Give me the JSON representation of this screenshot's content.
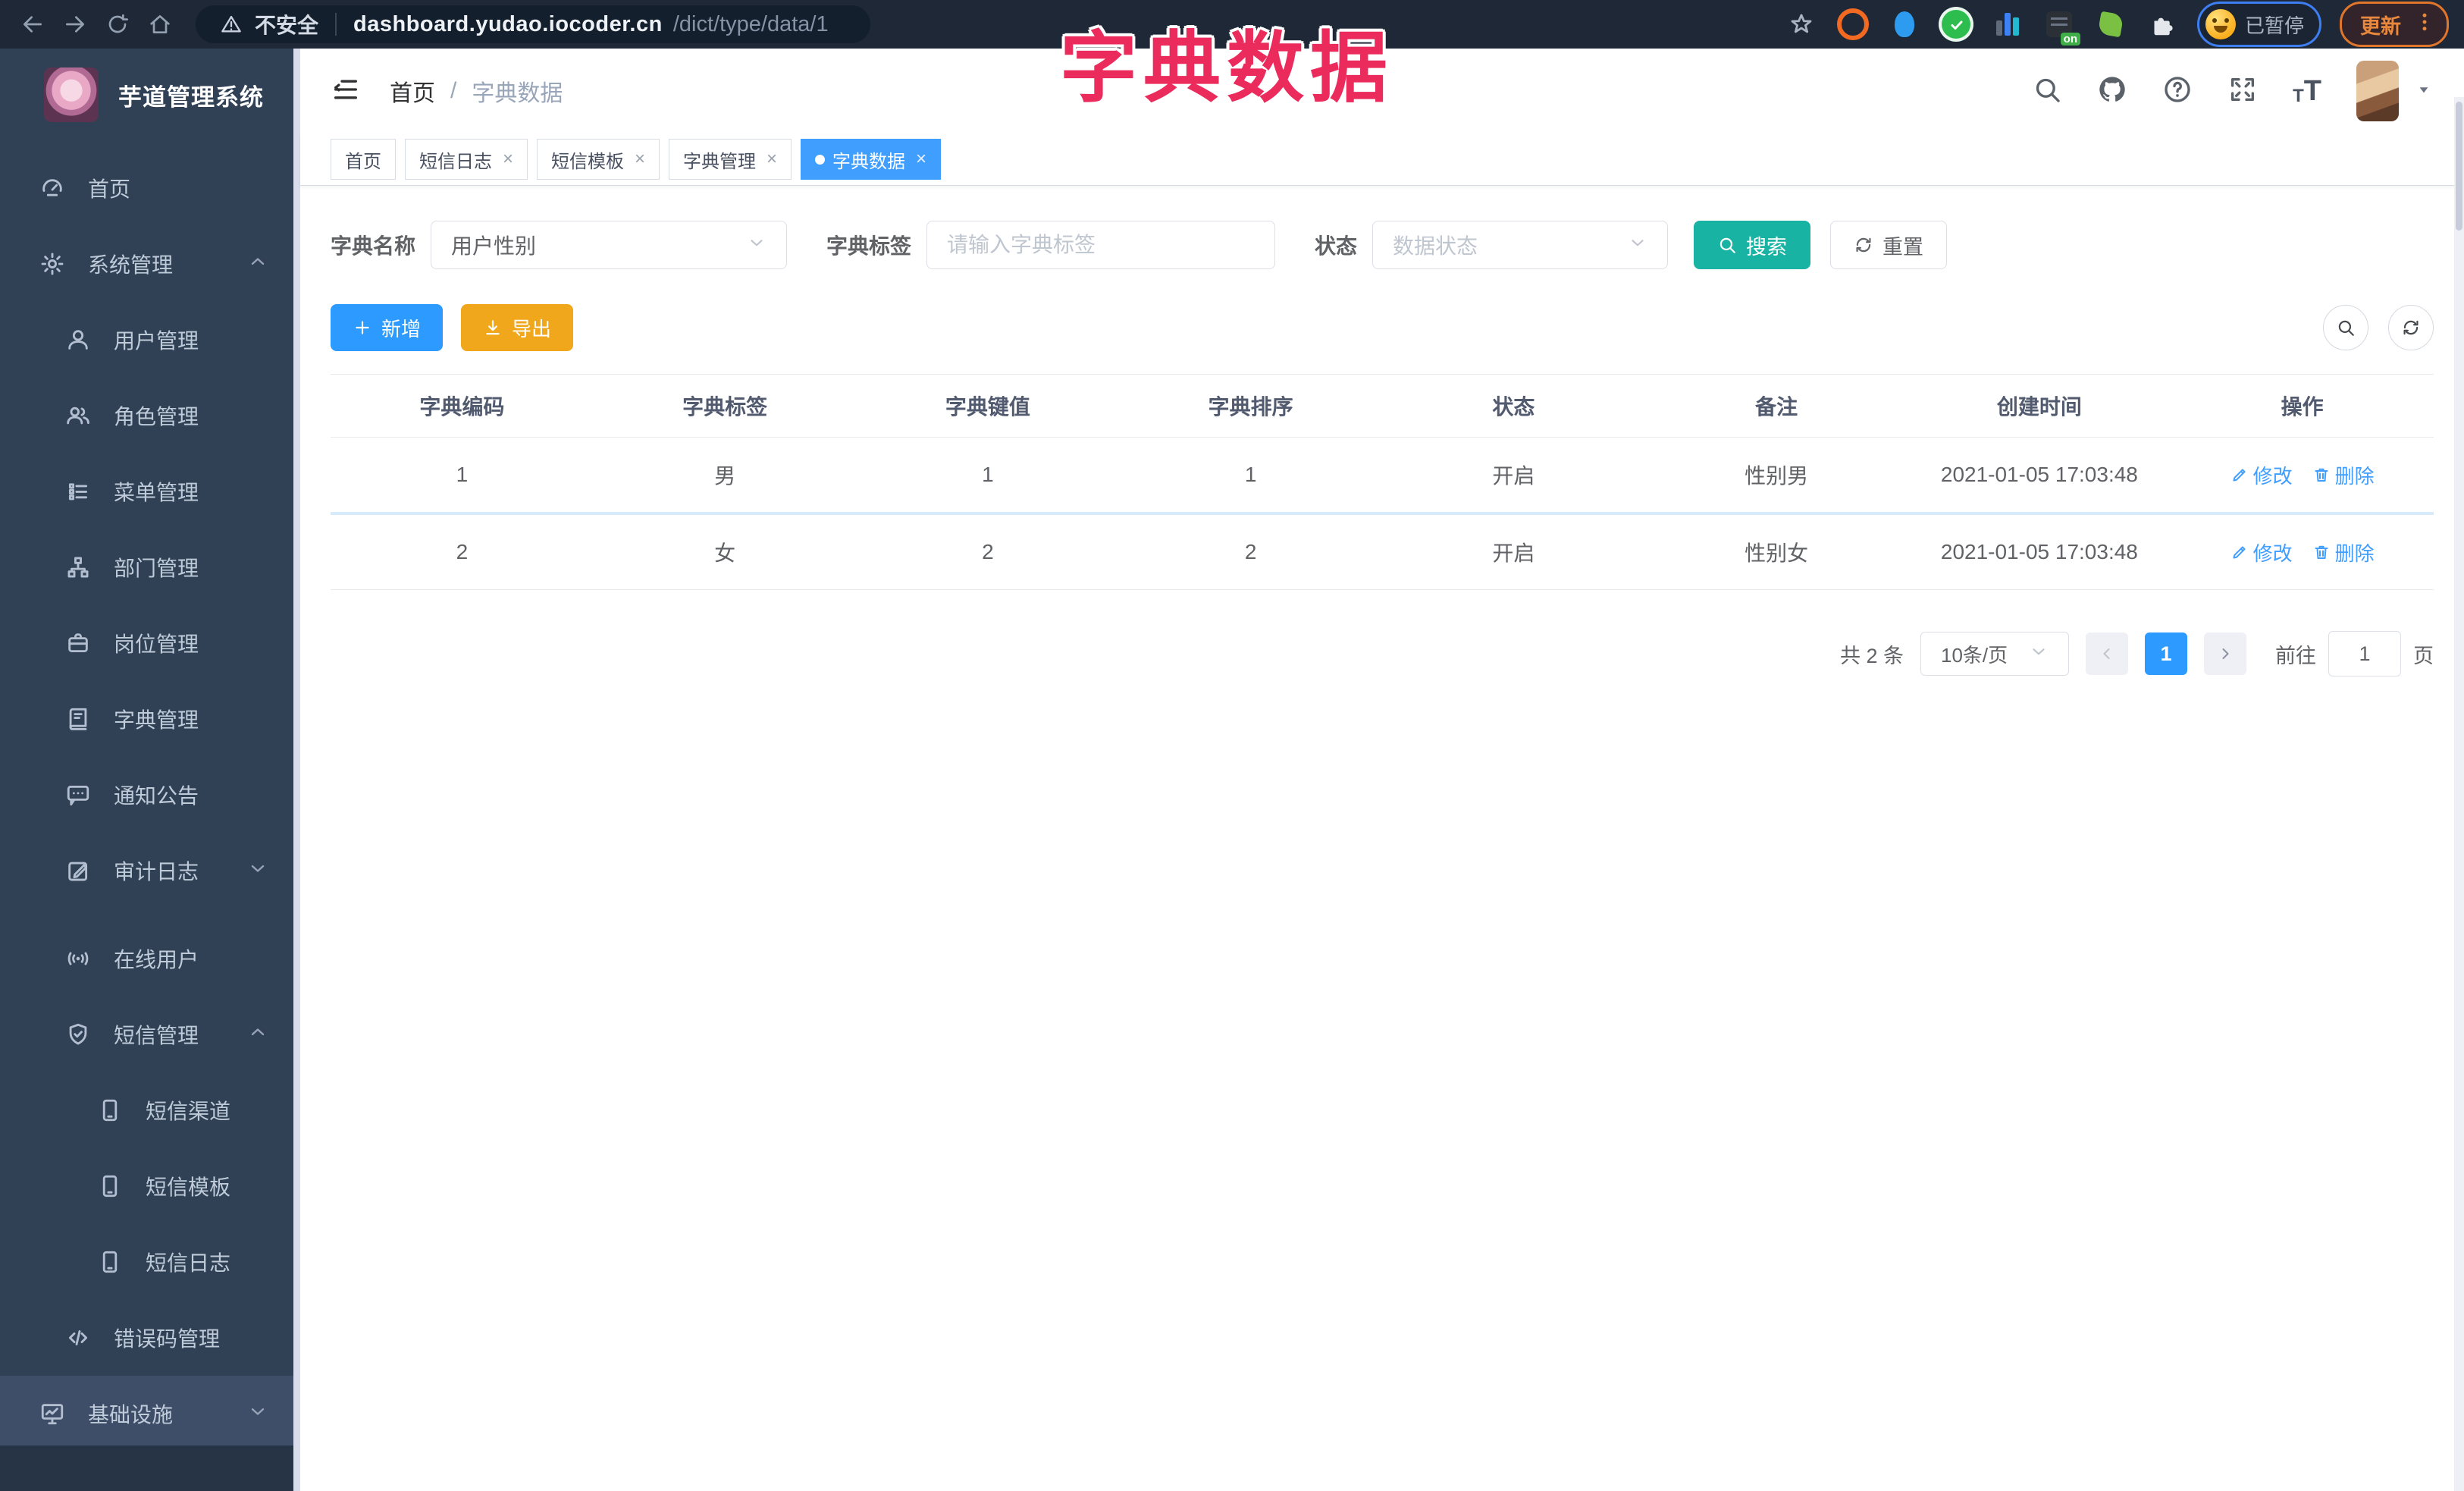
{
  "browser": {
    "security_label": "不安全",
    "url_domain": "dashboard.yudao.iocoder.cn",
    "url_path": "/dict/type/data/1",
    "extension_on_badge": "on",
    "paused_label": "已暂停",
    "update_label": "更新"
  },
  "overlay_title": "字典数据",
  "sidebar": {
    "app_title": "芋道管理系统",
    "items": [
      {
        "label": "首页"
      },
      {
        "label": "系统管理"
      },
      {
        "label": "用户管理"
      },
      {
        "label": "角色管理"
      },
      {
        "label": "菜单管理"
      },
      {
        "label": "部门管理"
      },
      {
        "label": "岗位管理"
      },
      {
        "label": "字典管理"
      },
      {
        "label": "通知公告"
      },
      {
        "label": "审计日志"
      },
      {
        "label": "在线用户"
      },
      {
        "label": "短信管理"
      },
      {
        "label": "短信渠道"
      },
      {
        "label": "短信模板"
      },
      {
        "label": "短信日志"
      },
      {
        "label": "错误码管理"
      },
      {
        "label": "基础设施"
      }
    ]
  },
  "header": {
    "breadcrumb_home": "首页",
    "breadcrumb_sep": "/",
    "breadcrumb_current": "字典数据"
  },
  "tabs": [
    {
      "label": "首页"
    },
    {
      "label": "短信日志"
    },
    {
      "label": "短信模板"
    },
    {
      "label": "字典管理"
    },
    {
      "label": "字典数据"
    }
  ],
  "filters": {
    "dict_name_label": "字典名称",
    "dict_name_value": "用户性别",
    "dict_label_label": "字典标签",
    "dict_label_placeholder": "请输入字典标签",
    "status_label": "状态",
    "status_placeholder": "数据状态",
    "search_button": "搜索",
    "reset_button": "重置"
  },
  "toolbar": {
    "add_button": "新增",
    "export_button": "导出"
  },
  "table": {
    "headers": [
      "字典编码",
      "字典标签",
      "字典键值",
      "字典排序",
      "状态",
      "备注",
      "创建时间",
      "操作"
    ],
    "op_edit": "修改",
    "op_delete": "删除",
    "rows": [
      {
        "code": "1",
        "label": "男",
        "value": "1",
        "sort": "1",
        "status": "开启",
        "remark": "性别男",
        "created": "2021-01-05 17:03:48"
      },
      {
        "code": "2",
        "label": "女",
        "value": "2",
        "sort": "2",
        "status": "开启",
        "remark": "性别女",
        "created": "2021-01-05 17:03:48"
      }
    ]
  },
  "pagination": {
    "total": "共 2 条",
    "page_size": "10条/页",
    "current_page": "1",
    "goto_label": "前往",
    "goto_value": "1",
    "page_unit": "页"
  },
  "colors": {
    "primary": "#409eff",
    "search_teal": "#18b3a3",
    "export_orange": "#f0a71c",
    "sidebar_bg": "#304156",
    "annotation_red": "#ea2b5c"
  }
}
